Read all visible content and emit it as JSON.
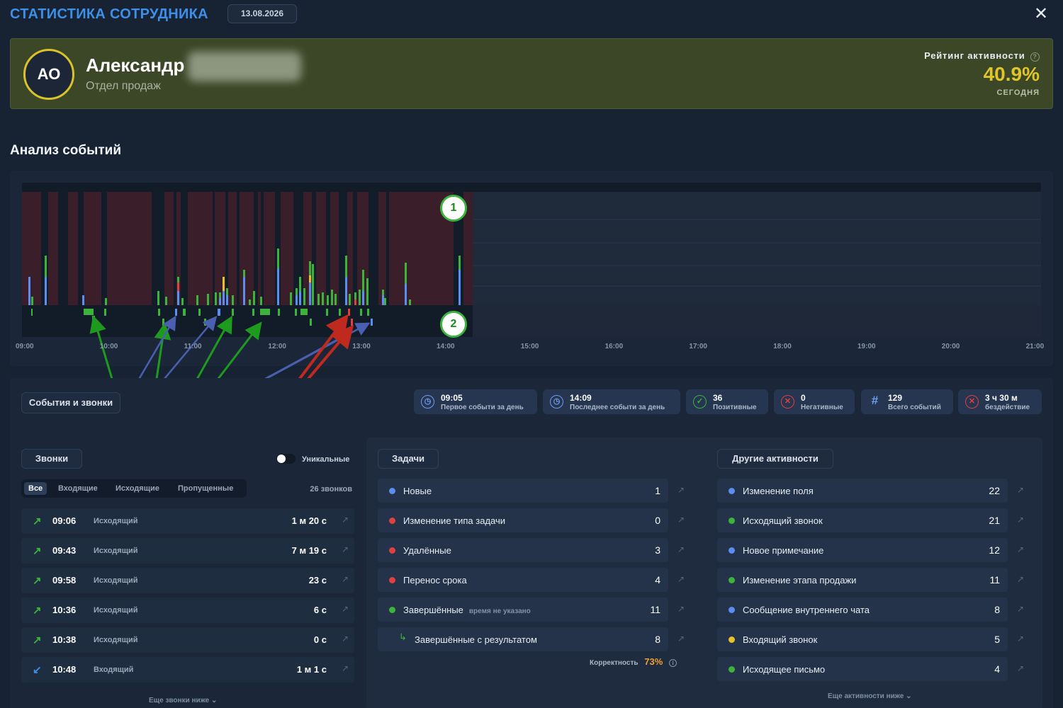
{
  "header": {
    "title": "СТАТИСТИКА СОТРУДНИКА",
    "date": "13.08.2026"
  },
  "profile": {
    "initials": "АО",
    "name": "Александр",
    "department": "Отдел продаж",
    "rating_label": "Рейтинг активности",
    "rating_value": "40.9%",
    "rating_period": "сегодня"
  },
  "events": {
    "title": "Анализ событий",
    "timeline_labels": [
      "09:00",
      "10:00",
      "11:00",
      "12:00",
      "13:00",
      "14:00",
      "15:00",
      "16:00",
      "17:00",
      "18:00",
      "19:00",
      "20:00",
      "21:00"
    ],
    "markers": [
      "1",
      "2"
    ]
  },
  "colors": {
    "accent_blue": "#3d8fe8",
    "green": "#3cb43c",
    "red": "#e04040",
    "blue": "#5b8ef0",
    "yellow": "#e8c22c",
    "rating": "#e0c52a"
  },
  "tabs": {
    "main": "События и звонки"
  },
  "stats": [
    {
      "value": "09:05",
      "label": "Первое событи за день",
      "icon": "clock-icon"
    },
    {
      "value": "14:09",
      "label": "Последнее событи за день",
      "icon": "clock-icon"
    },
    {
      "value": "36",
      "label": "Позитивные",
      "icon": "check-icon"
    },
    {
      "value": "0",
      "label": "Негативные",
      "icon": "x-icon"
    },
    {
      "value": "129",
      "label": "Всего событий",
      "icon": "hash-icon"
    },
    {
      "value": "3 ч 30 м",
      "label": "бездействие",
      "icon": "x-icon"
    }
  ],
  "calls": {
    "title": "Звонки",
    "unique_label": "Уникальные",
    "filters": [
      "Все",
      "Входящие",
      "Исходящие",
      "Пропущенные"
    ],
    "count": "26 звонков",
    "rows": [
      {
        "time": "09:06",
        "kind": "Исходящий",
        "duration": "1 м 20 с",
        "direction": "out"
      },
      {
        "time": "09:43",
        "kind": "Исходящий",
        "duration": "7 м 19 с",
        "direction": "out"
      },
      {
        "time": "09:58",
        "kind": "Исходящий",
        "duration": "23 с",
        "direction": "out"
      },
      {
        "time": "10:36",
        "kind": "Исходящий",
        "duration": "6 с",
        "direction": "out"
      },
      {
        "time": "10:38",
        "kind": "Исходящий",
        "duration": "0 с",
        "direction": "out"
      },
      {
        "time": "10:48",
        "kind": "Входящий",
        "duration": "1 м 1 с",
        "direction": "in"
      }
    ],
    "more": "Еще звонки ниже"
  },
  "tasks": {
    "title": "Задачи",
    "rows": [
      {
        "name": "Новые",
        "count": "1",
        "color": "#5b8ef0"
      },
      {
        "name": "Изменение типа задачи",
        "count": "0",
        "color": "#e04040"
      },
      {
        "name": "Удалённые",
        "count": "3",
        "color": "#e04040"
      },
      {
        "name": "Перенос срока",
        "count": "4",
        "color": "#e04040"
      },
      {
        "name": "Завершённые",
        "note": "время не указано",
        "count": "11",
        "color": "#3cb43c"
      },
      {
        "name": "Завершённые с результатом",
        "count": "8",
        "color": ""
      }
    ],
    "correctness_label": "Корректность",
    "correctness_value": "73%"
  },
  "other": {
    "title": "Другие активности",
    "rows": [
      {
        "name": "Изменение поля",
        "count": "22",
        "color": "#5b8ef0"
      },
      {
        "name": "Исходящий звонок",
        "count": "21",
        "color": "#3cb43c"
      },
      {
        "name": "Новое примечание",
        "count": "12",
        "color": "#5b8ef0"
      },
      {
        "name": "Изменение этапа продажи",
        "count": "11",
        "color": "#3cb43c"
      },
      {
        "name": "Сообщение внутреннего чата",
        "count": "8",
        "color": "#5b8ef0"
      },
      {
        "name": "Входящий звонок",
        "count": "5",
        "color": "#e8c22c"
      },
      {
        "name": "Исходящее письмо",
        "count": "4",
        "color": "#3cb43c"
      }
    ],
    "more": "Еще активности ниже"
  }
}
